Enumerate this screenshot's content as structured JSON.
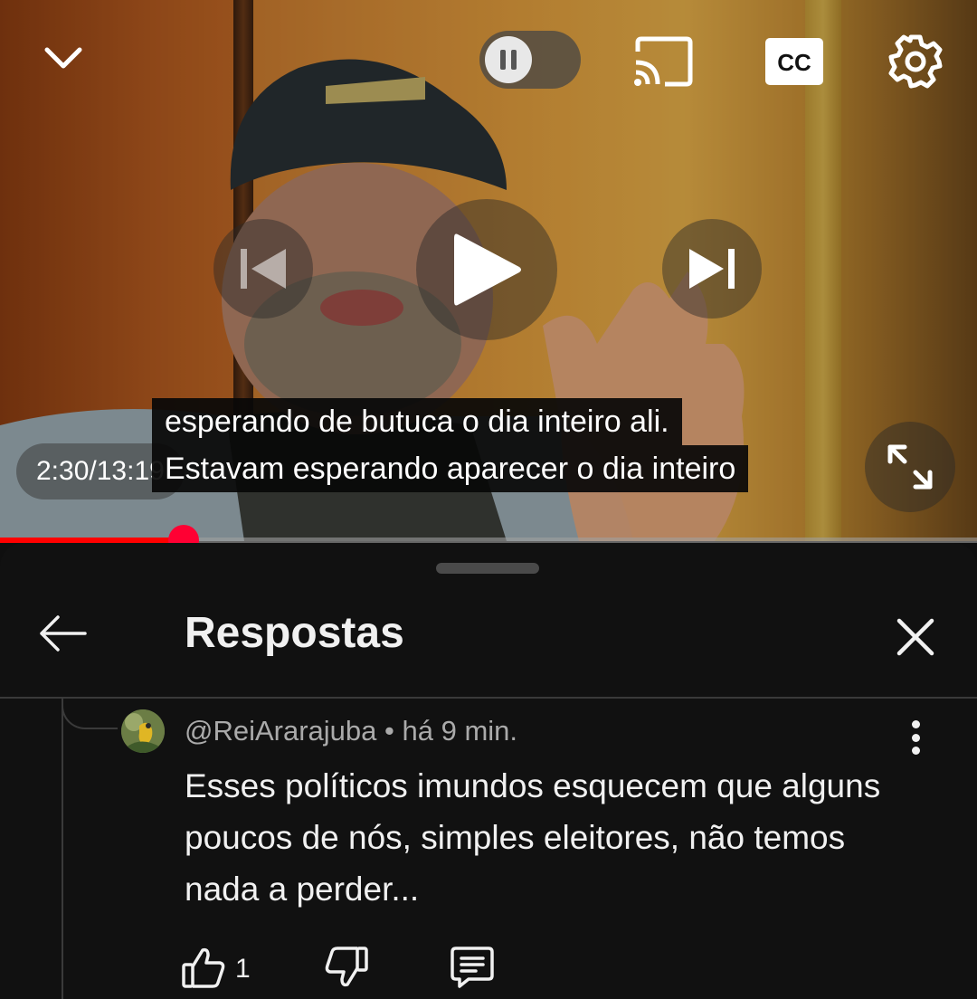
{
  "player": {
    "current_time": "2:30",
    "separator": " / ",
    "duration": "13:19",
    "progress": 0.188,
    "captions": [
      "esperando de butuca o dia inteiro ali.",
      "Estavam esperando aparecer o dia inteiro"
    ],
    "cc_label": "CC"
  },
  "panel": {
    "title": "Respostas"
  },
  "comment": {
    "author": "@ReiArarajuba",
    "separator": " • ",
    "time": "há 9 min.",
    "text": "Esses políticos imundos esquecem que alguns poucos de nós, simples eleitores, não temos nada a perder...",
    "like_count": "1"
  },
  "icons": {
    "collapse": "chevron-down-icon",
    "pause": "pause-icon",
    "cast": "cast-icon",
    "settings": "gear-icon",
    "previous": "skip-previous-icon",
    "play": "play-icon",
    "next": "skip-next-icon",
    "fullscreen": "fullscreen-icon",
    "back": "arrow-left-icon",
    "close": "close-icon",
    "more": "more-vertical-icon",
    "like": "thumbs-up-icon",
    "dislike": "thumbs-down-icon",
    "reply": "comment-icon"
  },
  "colors": {
    "progress": "#ff0000",
    "panel_bg": "#111111"
  }
}
